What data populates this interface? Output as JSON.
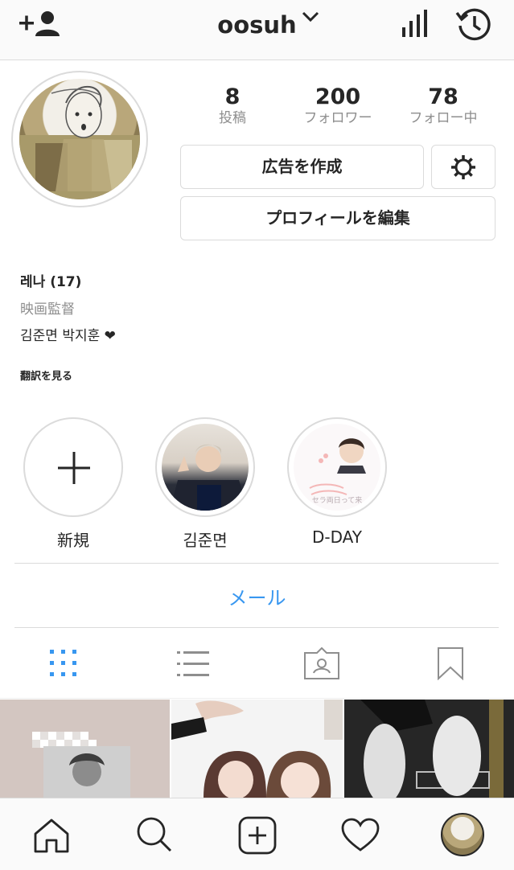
{
  "header": {
    "username": "oosuh",
    "icons": [
      "add-person-icon",
      "chevron-down-icon",
      "insights-icon",
      "archive-history-icon"
    ]
  },
  "profile": {
    "stats": [
      {
        "num": "8",
        "label": "投稿"
      },
      {
        "num": "200",
        "label": "フォロワー"
      },
      {
        "num": "78",
        "label": "フォロー中"
      }
    ],
    "create_ad_label": "広告を作成",
    "edit_profile_label": "プロフィールを編集",
    "bio": {
      "name": "레나 (17)",
      "job": "映画監督",
      "text": "김준면 박지훈 ❤",
      "translate": "翻訳を見る"
    }
  },
  "highlights": [
    {
      "label": "新規"
    },
    {
      "label": "김준면"
    },
    {
      "label": "D-DAY",
      "overlay_text": "セラ両日って来"
    }
  ],
  "contact": {
    "mail_label": "メール"
  },
  "tabs": [
    "grid-icon",
    "list-icon",
    "tagged-icon",
    "saved-icon"
  ],
  "colors": {
    "link": "#3897f0",
    "active_tab": "#3897f0",
    "border": "#dbdbdb",
    "secondary_text": "#8e8e8e"
  },
  "bottom_nav": [
    "home-icon",
    "search-icon",
    "new-post-icon",
    "activity-heart-icon",
    "profile-avatar"
  ]
}
